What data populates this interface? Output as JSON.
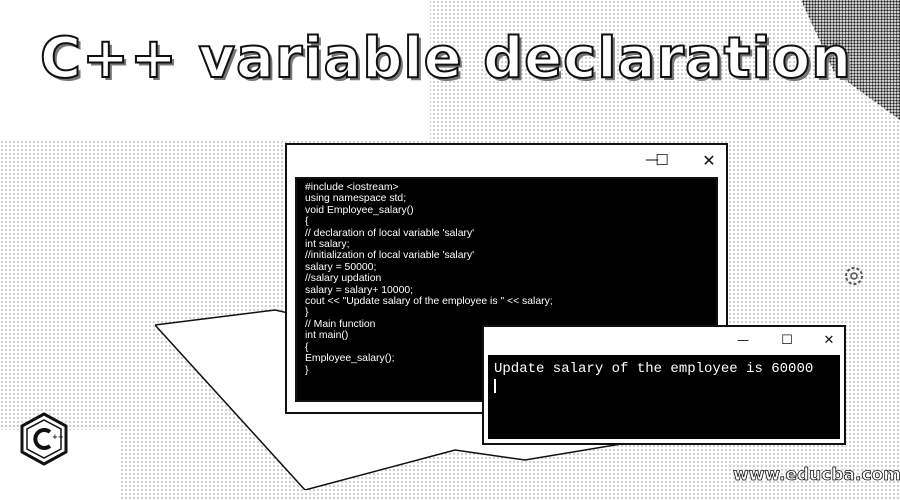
{
  "heading": "C++ variable declaration",
  "editor_window": {
    "controls": {
      "minimize": "—",
      "maximize": "☐",
      "close": "✕"
    },
    "code_lines": [
      "#include <iostream>",
      "using namespace std;",
      "void Employee_salary()",
      "{",
      "// declaration of local variable 'salary'",
      "int salary;",
      "//initialization of local variable 'salary'",
      "salary = 50000;",
      "//salary updation",
      "salary = salary+ 10000;",
      "cout << \"Update salary of the employee is \" << salary;",
      "}",
      "// Main function",
      "int main()",
      "{",
      "Employee_salary();",
      "}"
    ]
  },
  "console_window": {
    "controls": {
      "minimize": "—",
      "maximize": "☐",
      "close": "✕"
    },
    "output": "Update salary of the employee is 60000"
  },
  "branding": {
    "url": "www.educba.com",
    "logo_icon": "cpp-logo-icon"
  },
  "colors": {
    "code_background": "#000000",
    "code_text": "#ffffff",
    "window_border": "#111111"
  }
}
